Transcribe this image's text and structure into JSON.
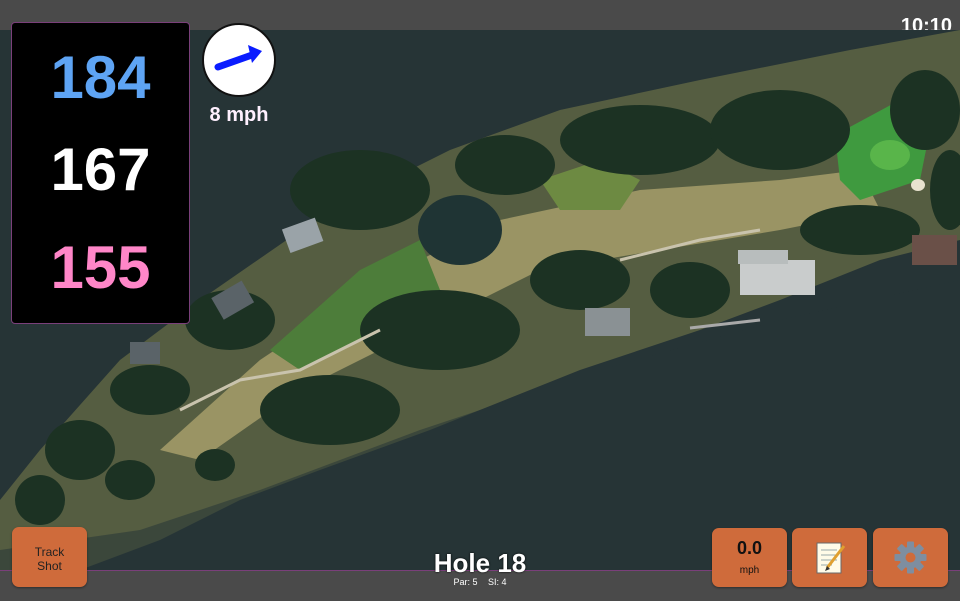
{
  "clock": "10:10",
  "distances": {
    "back": "184",
    "middle": "167",
    "front": "155"
  },
  "wind": {
    "speed_label": "8 mph",
    "icon": "wind-arrow-icon"
  },
  "buttons": {
    "track_line1": "Track",
    "track_line2": "Shot",
    "speed_value": "0.0",
    "speed_unit": "mph",
    "notes_icon": "notepad-icon",
    "settings_icon": "gear-icon"
  },
  "hole": {
    "title": "Hole 18",
    "par": "Par: 5",
    "si": "SI: 4"
  },
  "colors": {
    "back": "#5ea4f4",
    "middle": "#ffffff",
    "front": "#ff86c8",
    "button": "#cf6b3b",
    "accent_border": "#7a3f7a"
  }
}
